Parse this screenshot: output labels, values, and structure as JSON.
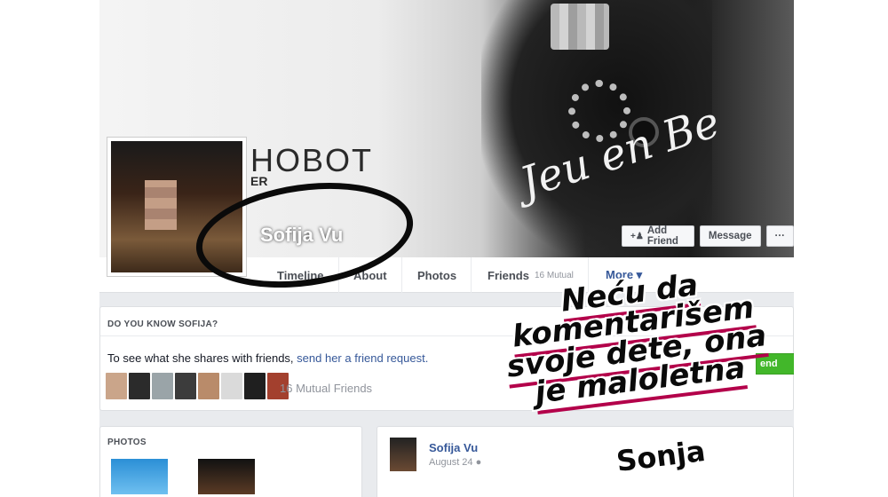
{
  "cover": {
    "brand": "HOBOT",
    "brand_sub": "ER",
    "shirt_text": "Jeu en Be"
  },
  "profile": {
    "name": "Sofija Vu"
  },
  "actions": {
    "add_friend": "Add Friend",
    "add_friend_icon": "add-person-icon",
    "message": "Message",
    "more_dots": "···"
  },
  "nav": {
    "timeline": "Timeline",
    "about": "About",
    "photos": "Photos",
    "friends": "Friends",
    "friends_count": "16 Mutual",
    "more": "More ▾"
  },
  "know": {
    "heading": "DO YOU KNOW SOFIJA?",
    "text_prefix": "To see what she shares with friends, ",
    "link": "send her a friend request.",
    "mutual": "16 Mutual Friends",
    "button_fragment": "end"
  },
  "photos": {
    "heading": "PHOTOS"
  },
  "post": {
    "author": "Sofija Vu",
    "date": "August 24",
    "privacy_icon": "globe-icon"
  },
  "overlay": {
    "headline_lines": [
      "Neću da",
      "komentarišem",
      "svoje dete, ona",
      "je maloletna"
    ],
    "signature": "Sonja",
    "accent": "#b3004a"
  },
  "colors": {
    "link": "#365899",
    "green": "#42b72a"
  }
}
